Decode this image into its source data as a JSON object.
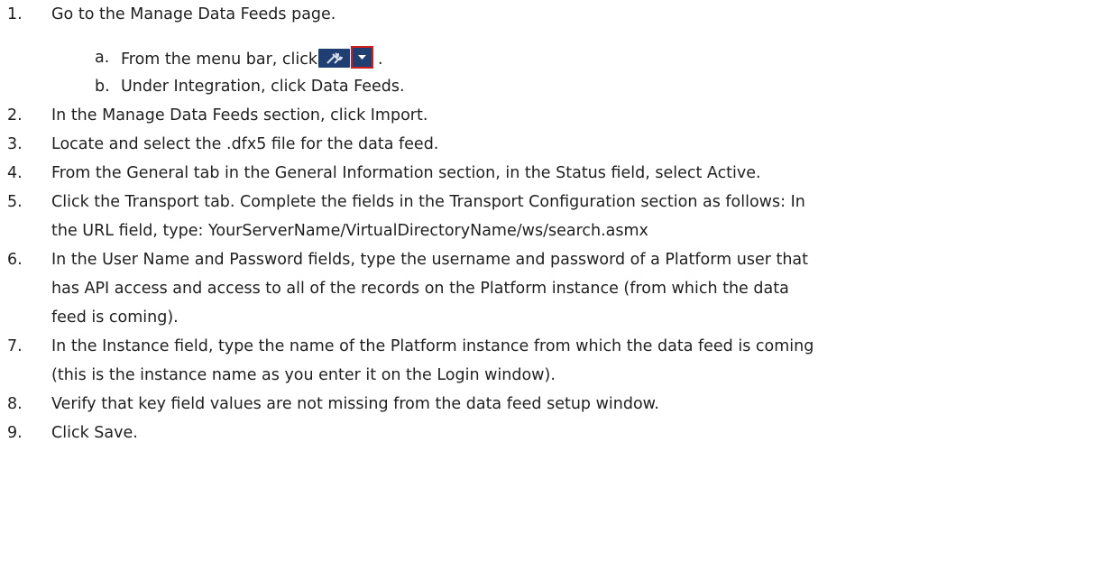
{
  "steps": [
    {
      "number": "1.",
      "text": "Go to the Manage Data Feeds page."
    },
    {
      "number": "2.",
      "text": "In the Manage Data Feeds section, click Import."
    },
    {
      "number": "3.",
      "text": "Locate and select the .dfx5 file for the data feed."
    },
    {
      "number": "4.",
      "text": "From the General tab in the General Information section, in the Status field, select Active."
    },
    {
      "number": "5.",
      "text": "Click the Transport tab. Complete the fields in the Transport Configuration section as follows: In",
      "cont": [
        "the URL field, type: YourServerName/VirtualDirectoryName/ws/search.asmx"
      ]
    },
    {
      "number": "6.",
      "text": "In the User Name and Password fields, type the username and password of a Platform user that",
      "cont": [
        "has API access and access to all of the records on the Platform instance (from which the data",
        "feed is coming)."
      ]
    },
    {
      "number": "7.",
      "text": "In the Instance field, type the name of the Platform instance from which the data feed is coming",
      "cont": [
        "(this is the instance name as you enter it on the Login window)."
      ]
    },
    {
      "number": "8.",
      "text": "Verify that key field values are not missing from the data feed setup window."
    },
    {
      "number": "9.",
      "text": "Click Save."
    }
  ],
  "substeps": [
    {
      "letter": "a.",
      "text": "From the menu bar, click",
      "suffix": "."
    },
    {
      "letter": "b.",
      "text": "Under Integration, click Data Feeds."
    }
  ],
  "icons": {
    "toolbar_button": "tools-icon",
    "dropdown_button": "chevron-down-icon",
    "button_color": "#1f3f73",
    "highlight_color": "#d01c1c"
  }
}
